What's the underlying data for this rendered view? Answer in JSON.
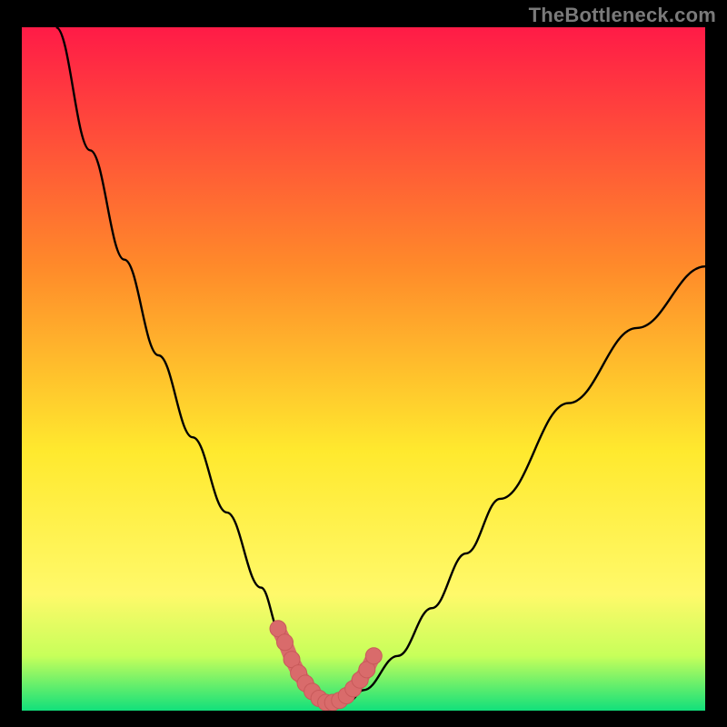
{
  "attribution": "TheBottleneck.com",
  "colors": {
    "background": "#000000",
    "gradient_top": "#ff1b47",
    "gradient_mid_upper": "#ff8a2a",
    "gradient_mid": "#ffe92e",
    "gradient_lower": "#c7ff5a",
    "gradient_bottom": "#11e07b",
    "curve": "#000000",
    "marker": "#d96b6b",
    "marker_stroke": "#c85a5a"
  },
  "chart_data": {
    "type": "line",
    "title": "",
    "xlabel": "",
    "ylabel": "",
    "xlim": [
      0,
      100
    ],
    "ylim": [
      0,
      100
    ],
    "series": [
      {
        "name": "bottleneck-curve",
        "x": [
          5,
          10,
          15,
          20,
          25,
          30,
          35,
          38,
          40,
          42,
          44,
          46,
          48,
          50,
          55,
          60,
          65,
          70,
          80,
          90,
          100
        ],
        "y": [
          100,
          82,
          66,
          52,
          40,
          29,
          18,
          11,
          6,
          3,
          1.5,
          1,
          1.5,
          3,
          8,
          15,
          23,
          31,
          45,
          56,
          65
        ]
      }
    ],
    "markers": {
      "name": "highlighted-segment",
      "x": [
        37.5,
        38.5,
        39.5,
        40.5,
        41.5,
        42.5,
        43.5,
        44.5,
        45.5,
        46.5,
        47.5,
        48.5,
        49.5,
        50.5,
        51.5
      ],
      "y": [
        12,
        10,
        7.5,
        5.5,
        4,
        2.8,
        1.8,
        1.2,
        1.2,
        1.5,
        2.2,
        3.2,
        4.5,
        6,
        8
      ]
    }
  }
}
